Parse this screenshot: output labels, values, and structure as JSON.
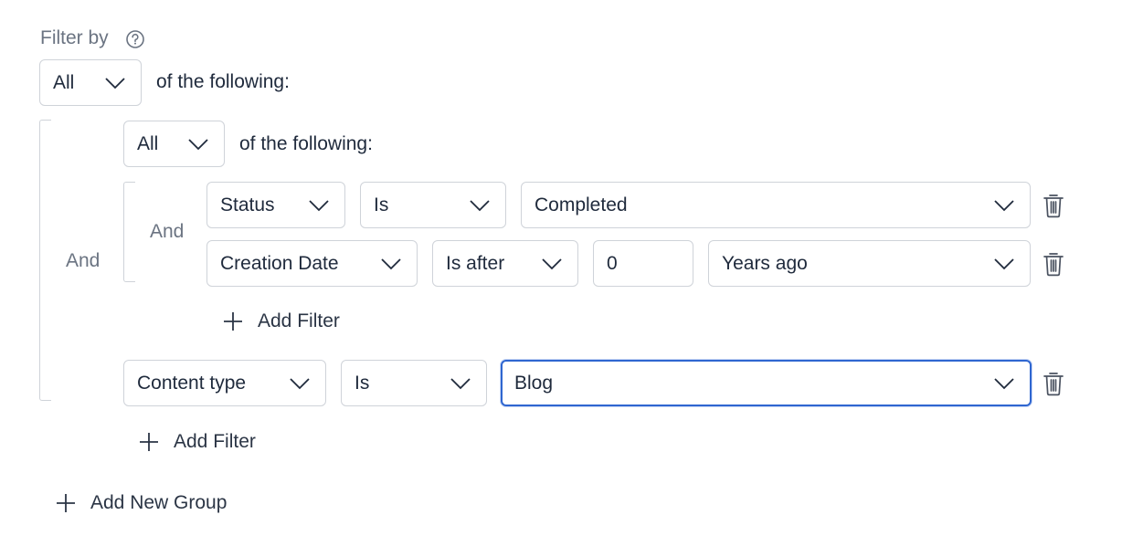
{
  "header": {
    "title": "Filter by",
    "help_icon": "help-circle-icon"
  },
  "root": {
    "match": "All",
    "suffix": "of the following:",
    "connector": "And",
    "add_group_label": "Add New Group"
  },
  "group": {
    "match": "All",
    "suffix": "of the following:",
    "add_filter_label": "Add Filter",
    "subgroup": {
      "connector": "And",
      "add_filter_label": "Add Filter",
      "rows": [
        {
          "field": "Status",
          "operator": "Is",
          "value": "Completed"
        },
        {
          "field": "Creation Date",
          "operator": "Is after",
          "amount": "0",
          "unit": "Years ago"
        }
      ]
    },
    "row": {
      "field": "Content type",
      "operator": "Is",
      "value": "Blog"
    }
  },
  "colors": {
    "border": "#cfd3d9",
    "focus": "#2f66d0",
    "text": "#1f2a3c",
    "muted": "#6b7482"
  }
}
